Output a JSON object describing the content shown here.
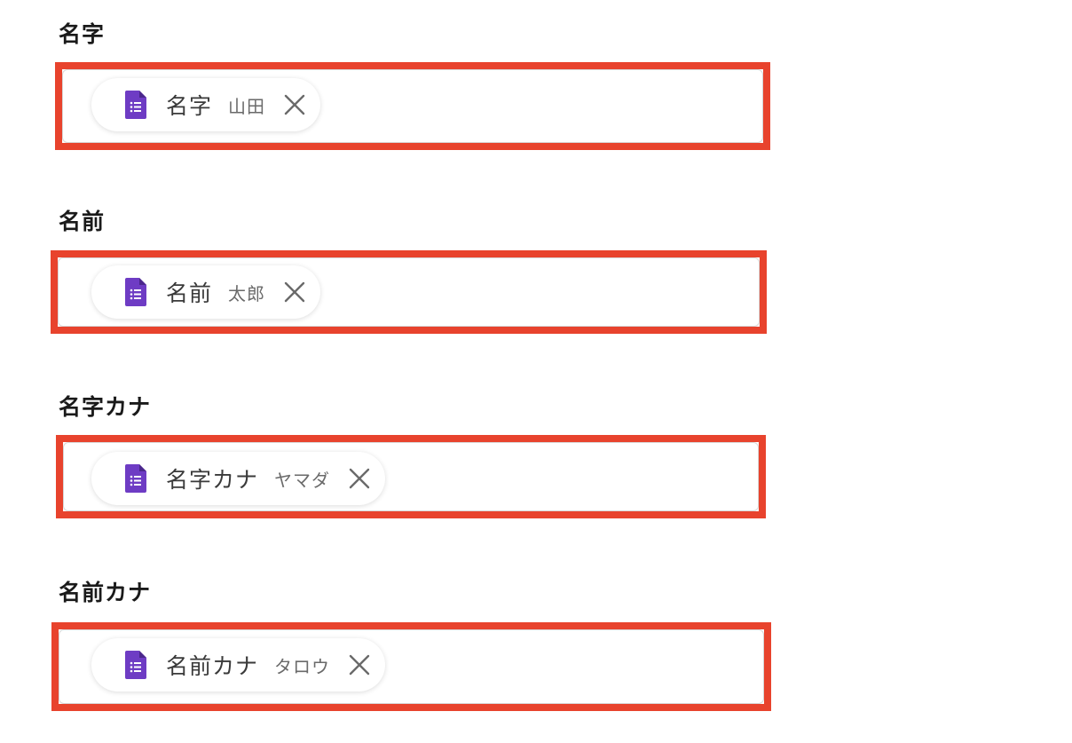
{
  "fields": [
    {
      "label": "名字",
      "chip": {
        "name": "名字",
        "value": "山田",
        "icon": "google-forms-icon",
        "remove_icon": "close-icon"
      }
    },
    {
      "label": "名前",
      "chip": {
        "name": "名前",
        "value": "太郎",
        "icon": "google-forms-icon",
        "remove_icon": "close-icon"
      }
    },
    {
      "label": "名字カナ",
      "chip": {
        "name": "名字カナ",
        "value": "ヤマダ",
        "icon": "google-forms-icon",
        "remove_icon": "close-icon"
      }
    },
    {
      "label": "名前カナ",
      "chip": {
        "name": "名前カナ",
        "value": "タロウ",
        "icon": "google-forms-icon",
        "remove_icon": "close-icon"
      }
    }
  ],
  "colors": {
    "highlight": "#e8432d",
    "forms_icon": "#6e3cc4",
    "label_text": "#1a1a1a",
    "chip_value_text": "#6a6a6a"
  }
}
